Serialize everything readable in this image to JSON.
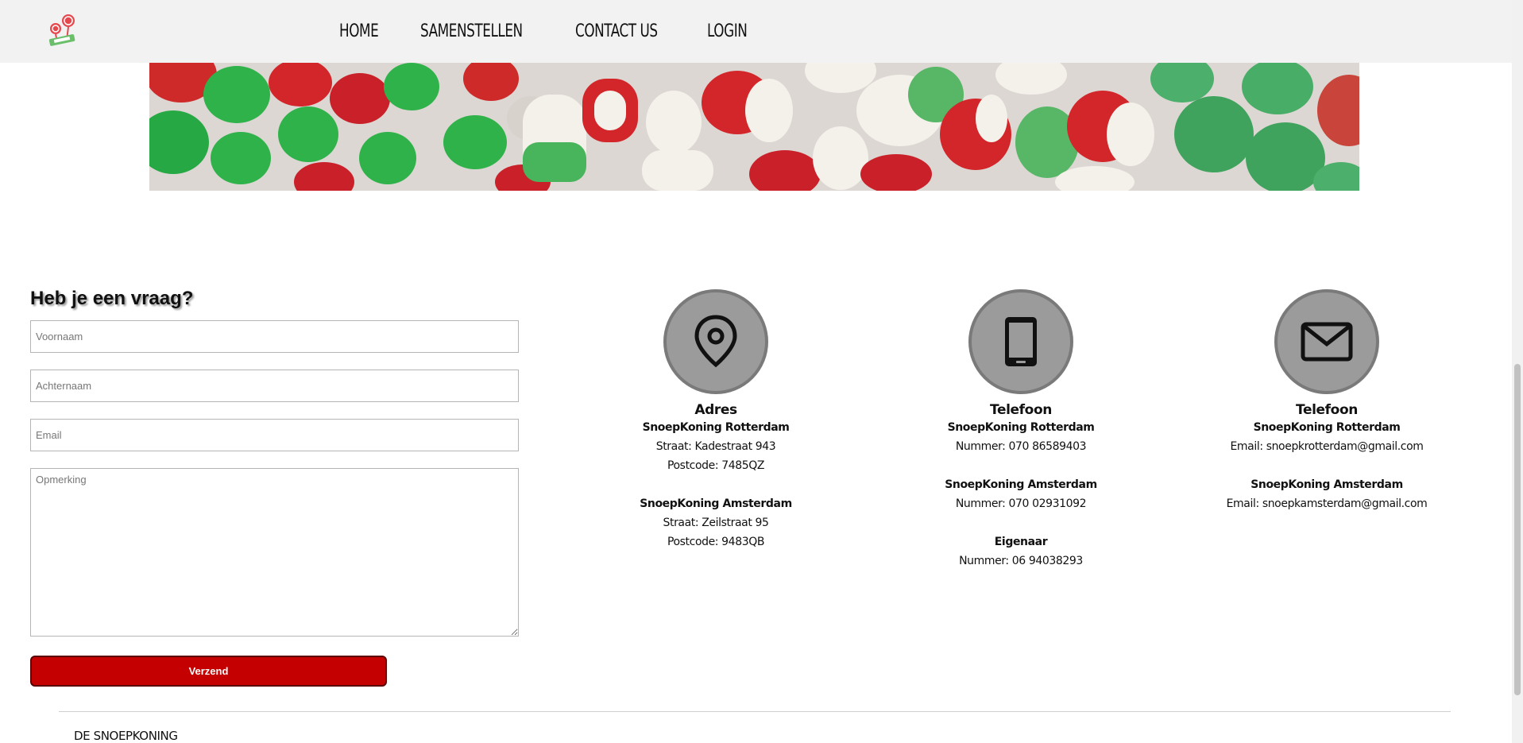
{
  "header": {
    "logo_name": "candy-logo",
    "nav": [
      {
        "label": "HOME"
      },
      {
        "label": "SAMENSTELLEN"
      },
      {
        "label": "CONTACT US"
      },
      {
        "label": "LOGIN"
      }
    ]
  },
  "banner": {
    "image_name": "candy-banner-image",
    "colors": [
      "#2fb24a",
      "#d3262a",
      "#f4f1ea",
      "#4caf6c"
    ]
  },
  "form": {
    "title": "Heb je een vraag?",
    "firstname_placeholder": "Voornaam",
    "lastname_placeholder": "Achternaam",
    "email_placeholder": "Email",
    "remark_placeholder": "Opmerking",
    "submit_label": "Verzend",
    "submit_color": "#c40000"
  },
  "info": {
    "address": {
      "icon": "location-pin-icon",
      "heading": "Adres",
      "blocks": [
        {
          "name": "SnoepKoning Rotterdam",
          "lines": [
            "Straat: Kadestraat 943",
            "Postcode: 7485QZ"
          ]
        },
        {
          "name": "SnoepKoning Amsterdam",
          "lines": [
            "Straat: Zeilstraat 95",
            "Postcode: 9483QB"
          ]
        }
      ]
    },
    "phone": {
      "icon": "phone-icon",
      "heading": "Telefoon",
      "blocks": [
        {
          "name": "SnoepKoning Rotterdam",
          "lines": [
            "Nummer: 070 86589403"
          ]
        },
        {
          "name": "SnoepKoning Amsterdam",
          "lines": [
            "Nummer: 070 02931092"
          ]
        },
        {
          "name": "Eigenaar",
          "lines": [
            "Nummer: 06 94038293"
          ]
        }
      ]
    },
    "email": {
      "icon": "envelope-icon",
      "heading": "Telefoon",
      "blocks": [
        {
          "name": "SnoepKoning Rotterdam",
          "lines": [
            "Email: snoepkrotterdam@gmail.com"
          ]
        },
        {
          "name": "SnoepKoning Amsterdam",
          "lines": [
            "Email: snoepkamsterdam@gmail.com"
          ]
        }
      ]
    }
  },
  "footer": {
    "brand": "DE SNOEPKONING"
  }
}
